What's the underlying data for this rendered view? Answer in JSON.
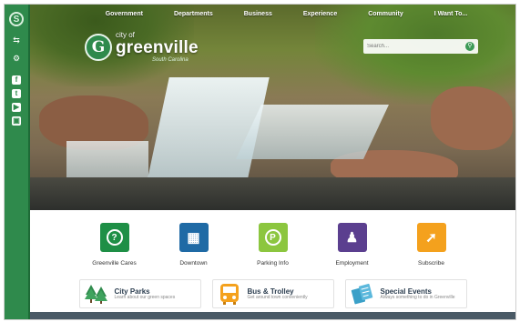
{
  "nav": {
    "items": [
      "Government",
      "Departments",
      "Business",
      "Experience",
      "Community",
      "I Want To..."
    ]
  },
  "logo": {
    "badge_letter": "G",
    "city_of": "city of",
    "name": "greenville",
    "tagline": "South Carolina"
  },
  "search": {
    "placeholder": "Search..."
  },
  "sidebar": {
    "badge_letter": "S",
    "social": [
      "f",
      "t",
      "▶",
      "▣"
    ]
  },
  "quick_links": [
    {
      "label": "Greenville Cares",
      "color": "#1e8f46",
      "icon": "question-icon",
      "glyph": "?"
    },
    {
      "label": "Downtown",
      "color": "#1f6aa5",
      "icon": "building-icon",
      "glyph": "▦"
    },
    {
      "label": "Parking Info",
      "color": "#8cc63f",
      "icon": "parking-icon",
      "glyph": "P"
    },
    {
      "label": "Employment",
      "color": "#5b3f8f",
      "icon": "person-icon",
      "glyph": "♟"
    },
    {
      "label": "Subscribe",
      "color": "#f4a11d",
      "icon": "paper-plane-icon",
      "glyph": "➚"
    }
  ],
  "feature_cards": [
    {
      "title": "City Parks",
      "subtitle": "Learn about our green spaces",
      "icon": "tree-icon",
      "color": "#2f8a4c"
    },
    {
      "title": "Bus & Trolley",
      "subtitle": "Get around town conveniently",
      "icon": "bus-icon",
      "color": "#f4a11d"
    },
    {
      "title": "Special Events",
      "subtitle": "Always something to do in Greenville",
      "icon": "ticket-icon",
      "color": "#3aa0c8"
    }
  ]
}
